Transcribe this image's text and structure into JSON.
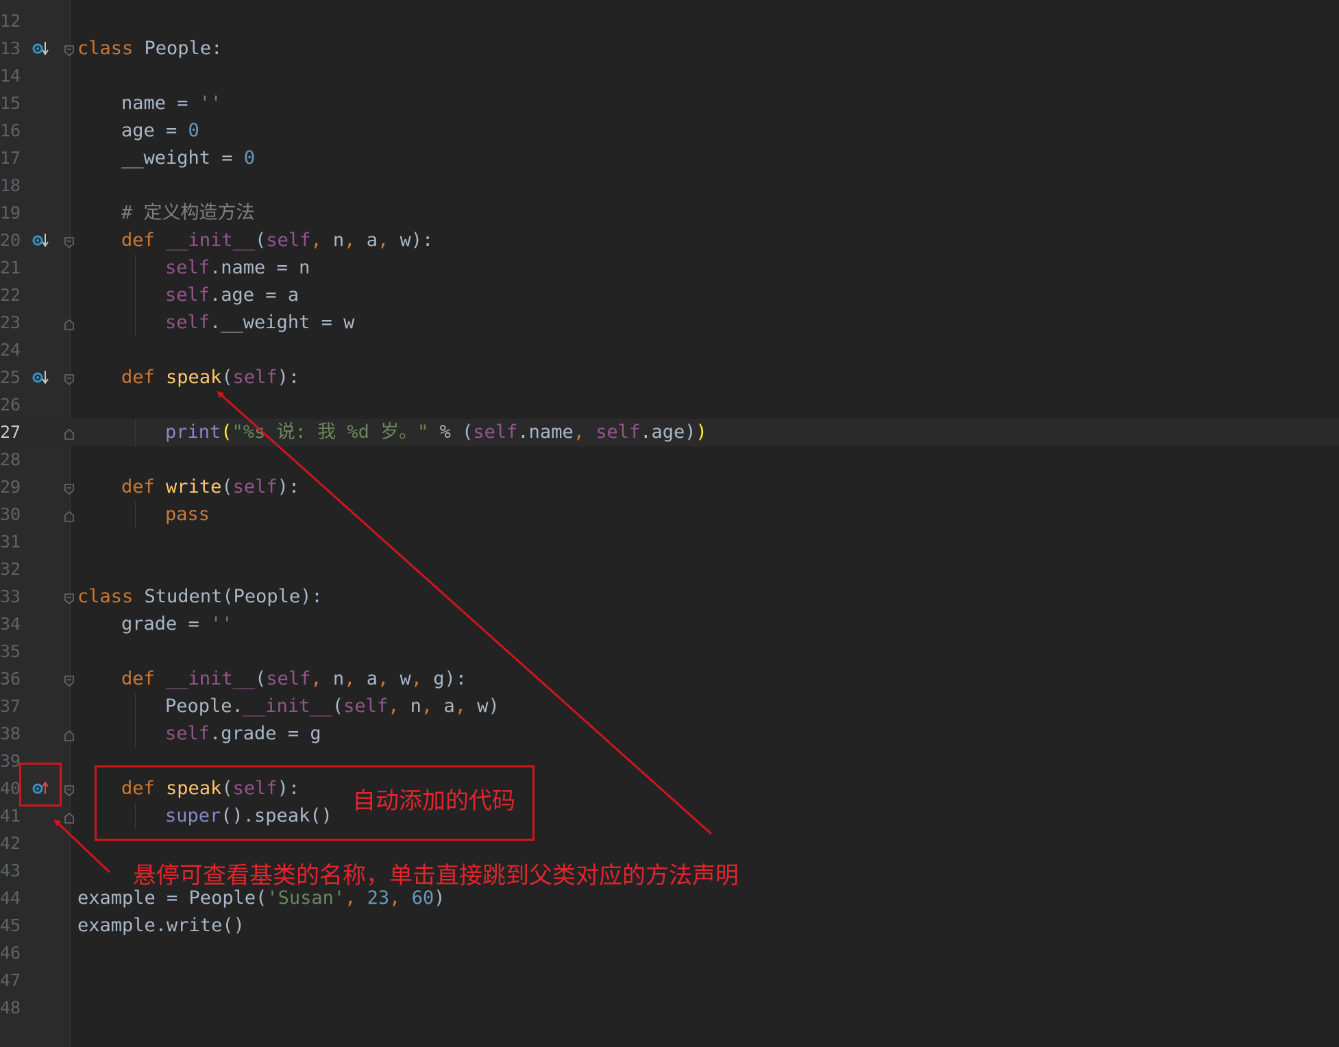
{
  "editor": {
    "lines": [
      {
        "n": "12",
        "tokens": []
      },
      {
        "n": "13",
        "marker": "override",
        "fold": "open",
        "tokens": [
          {
            "t": "class",
            "c": "kw"
          },
          {
            "t": " People:",
            "c": "pl"
          }
        ]
      },
      {
        "n": "14",
        "tokens": []
      },
      {
        "n": "15",
        "indent": 1,
        "tokens": [
          {
            "t": "name = ",
            "c": "pl"
          },
          {
            "t": "''",
            "c": "str"
          }
        ]
      },
      {
        "n": "16",
        "indent": 1,
        "tokens": [
          {
            "t": "age = ",
            "c": "pl"
          },
          {
            "t": "0",
            "c": "num"
          }
        ]
      },
      {
        "n": "17",
        "indent": 1,
        "tokens": [
          {
            "t": "__weight = ",
            "c": "pl"
          },
          {
            "t": "0",
            "c": "num"
          }
        ]
      },
      {
        "n": "18",
        "tokens": []
      },
      {
        "n": "19",
        "indent": 1,
        "tokens": [
          {
            "t": "# 定义构造方法",
            "c": "cm"
          }
        ]
      },
      {
        "n": "20",
        "marker": "override",
        "fold": "open",
        "indent": 1,
        "tokens": [
          {
            "t": "def",
            "c": "kw"
          },
          {
            "t": " ",
            "c": "pl"
          },
          {
            "t": "__init__",
            "c": "mg"
          },
          {
            "t": "(",
            "c": "pl"
          },
          {
            "t": "self",
            "c": "mg"
          },
          {
            "t": ", ",
            "c": "ct"
          },
          {
            "t": "n",
            "c": "pl"
          },
          {
            "t": ", ",
            "c": "ct"
          },
          {
            "t": "a",
            "c": "pl"
          },
          {
            "t": ", ",
            "c": "ct"
          },
          {
            "t": "w):",
            "c": "pl"
          }
        ]
      },
      {
        "n": "21",
        "indent": 2,
        "tokens": [
          {
            "t": "self",
            "c": "mg"
          },
          {
            "t": ".name = n",
            "c": "pl"
          }
        ]
      },
      {
        "n": "22",
        "indent": 2,
        "tokens": [
          {
            "t": "self",
            "c": "mg"
          },
          {
            "t": ".age = a",
            "c": "pl"
          }
        ]
      },
      {
        "n": "23",
        "fold": "close",
        "indent": 2,
        "tokens": [
          {
            "t": "self",
            "c": "mg"
          },
          {
            "t": ".__weight = w",
            "c": "pl"
          }
        ]
      },
      {
        "n": "24",
        "tokens": []
      },
      {
        "n": "25",
        "marker": "override",
        "fold": "open",
        "indent": 1,
        "tokens": [
          {
            "t": "def",
            "c": "kw"
          },
          {
            "t": " ",
            "c": "pl"
          },
          {
            "t": "speak",
            "c": "fn"
          },
          {
            "t": "(",
            "c": "pl"
          },
          {
            "t": "self",
            "c": "mg"
          },
          {
            "t": "):",
            "c": "pl"
          }
        ]
      },
      {
        "n": "26",
        "tokens": []
      },
      {
        "n": "27",
        "current": true,
        "fold": "close",
        "indent": 2,
        "tokens": [
          {
            "t": "print",
            "c": "bl"
          },
          {
            "t": "(",
            "c": "br"
          },
          {
            "t": "\"%s 说: 我 %d 岁。\"",
            "c": "str"
          },
          {
            "t": " % (",
            "c": "pl"
          },
          {
            "t": "self",
            "c": "mg"
          },
          {
            "t": ".name",
            "c": "pl"
          },
          {
            "t": ", ",
            "c": "ct"
          },
          {
            "t": "self",
            "c": "mg"
          },
          {
            "t": ".age)",
            "c": "pl"
          },
          {
            "t": ")",
            "c": "br"
          }
        ]
      },
      {
        "n": "28",
        "tokens": []
      },
      {
        "n": "29",
        "fold": "open",
        "indent": 1,
        "tokens": [
          {
            "t": "def",
            "c": "kw"
          },
          {
            "t": " ",
            "c": "pl"
          },
          {
            "t": "write",
            "c": "fn"
          },
          {
            "t": "(",
            "c": "pl"
          },
          {
            "t": "self",
            "c": "mg"
          },
          {
            "t": "):",
            "c": "pl"
          }
        ]
      },
      {
        "n": "30",
        "fold": "close",
        "indent": 2,
        "tokens": [
          {
            "t": "pass",
            "c": "kw"
          }
        ]
      },
      {
        "n": "31",
        "tokens": []
      },
      {
        "n": "32",
        "tokens": []
      },
      {
        "n": "33",
        "fold": "open",
        "tokens": [
          {
            "t": "class",
            "c": "kw"
          },
          {
            "t": " Student(People):",
            "c": "pl"
          }
        ]
      },
      {
        "n": "34",
        "indent": 1,
        "tokens": [
          {
            "t": "grade = ",
            "c": "pl"
          },
          {
            "t": "''",
            "c": "str"
          }
        ]
      },
      {
        "n": "35",
        "tokens": []
      },
      {
        "n": "36",
        "fold": "open",
        "indent": 1,
        "tokens": [
          {
            "t": "def",
            "c": "kw"
          },
          {
            "t": " ",
            "c": "pl"
          },
          {
            "t": "__init__",
            "c": "mg"
          },
          {
            "t": "(",
            "c": "pl"
          },
          {
            "t": "self",
            "c": "mg"
          },
          {
            "t": ", ",
            "c": "ct"
          },
          {
            "t": "n",
            "c": "pl"
          },
          {
            "t": ", ",
            "c": "ct"
          },
          {
            "t": "a",
            "c": "pl"
          },
          {
            "t": ", ",
            "c": "ct"
          },
          {
            "t": "w",
            "c": "pl"
          },
          {
            "t": ", ",
            "c": "ct"
          },
          {
            "t": "g):",
            "c": "pl"
          }
        ]
      },
      {
        "n": "37",
        "indent": 2,
        "tokens": [
          {
            "t": "People.",
            "c": "pl"
          },
          {
            "t": "__init__",
            "c": "mg"
          },
          {
            "t": "(",
            "c": "pl"
          },
          {
            "t": "self",
            "c": "mg"
          },
          {
            "t": ", ",
            "c": "ct"
          },
          {
            "t": "n",
            "c": "pl"
          },
          {
            "t": ", ",
            "c": "ct"
          },
          {
            "t": "a",
            "c": "pl"
          },
          {
            "t": ", ",
            "c": "ct"
          },
          {
            "t": "w)",
            "c": "pl"
          }
        ]
      },
      {
        "n": "38",
        "fold": "close",
        "indent": 2,
        "tokens": [
          {
            "t": "self",
            "c": "mg"
          },
          {
            "t": ".grade = g",
            "c": "pl"
          }
        ]
      },
      {
        "n": "39",
        "tokens": []
      },
      {
        "n": "40",
        "marker": "overridden",
        "fold": "open",
        "indent": 1,
        "tokens": [
          {
            "t": "def",
            "c": "kw"
          },
          {
            "t": " ",
            "c": "pl"
          },
          {
            "t": "speak",
            "c": "fn"
          },
          {
            "t": "(",
            "c": "pl"
          },
          {
            "t": "self",
            "c": "mg"
          },
          {
            "t": "):",
            "c": "pl"
          }
        ]
      },
      {
        "n": "41",
        "fold": "close",
        "indent": 2,
        "tokens": [
          {
            "t": "super",
            "c": "bl"
          },
          {
            "t": "().speak()",
            "c": "pl"
          }
        ]
      },
      {
        "n": "42",
        "tokens": []
      },
      {
        "n": "43",
        "tokens": []
      },
      {
        "n": "44",
        "tokens": [
          {
            "t": "example = People(",
            "c": "pl"
          },
          {
            "t": "'Susan'",
            "c": "str"
          },
          {
            "t": ", ",
            "c": "ct"
          },
          {
            "t": "23",
            "c": "num"
          },
          {
            "t": ", ",
            "c": "ct"
          },
          {
            "t": "60",
            "c": "num"
          },
          {
            "t": ")",
            "c": "pl"
          }
        ]
      },
      {
        "n": "45",
        "tokens": [
          {
            "t": "example.write()",
            "c": "pl"
          }
        ]
      },
      {
        "n": "46",
        "tokens": []
      },
      {
        "n": "47",
        "tokens": []
      },
      {
        "n": "48",
        "tokens": []
      }
    ]
  },
  "annotations": {
    "auto_added": "自动添加的代码",
    "hover_hint": "悬停可查看基类的名称，单击直接跳到父类对应的方法声明",
    "color": "#d0151d"
  },
  "colors": {
    "background": "#232323",
    "gutter": "#2b2b2b",
    "keyword": "#cc7832",
    "function": "#ffc66d",
    "magic": "#94558d",
    "builtin": "#8888c6",
    "number": "#6897bb",
    "string": "#6a8759",
    "comment": "#808080",
    "plain": "#a9b7c6"
  }
}
